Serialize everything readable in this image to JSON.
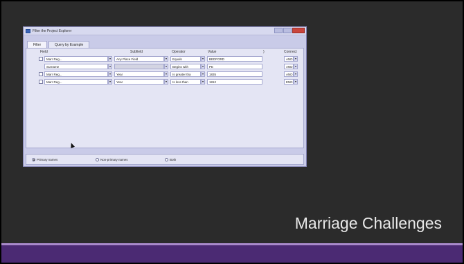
{
  "slide": {
    "title": "Marriage Challenges"
  },
  "screenshot": {
    "window_title": "Filter the Project Explorer",
    "tabs": [
      "Filter",
      "Query by Example"
    ],
    "headers": {
      "field": "Field",
      "subfield": "Subfield",
      "operator": "Operator",
      "value": "Value",
      "paren": ")",
      "connect": "Connect"
    },
    "rows": [
      {
        "field": "Marr Reg...",
        "subfield": "Any Place Field",
        "operator": "Equals",
        "value": "BEDFORD",
        "connect": "AND"
      },
      {
        "field": "Surname",
        "subfield": "",
        "operator": "Begins with",
        "value": "PE",
        "connect": "AND"
      },
      {
        "field": "Marr Reg...",
        "subfield": "Year",
        "operator": "Is greater tha",
        "value": "1835",
        "connect": "AND"
      },
      {
        "field": "Marr Reg...",
        "subfield": "Year",
        "operator": "Is less than",
        "value": "1812",
        "connect": "END"
      }
    ],
    "radios": [
      "Primary names",
      "Non-primary names",
      "Both"
    ],
    "selected_radio": "Primary names"
  }
}
